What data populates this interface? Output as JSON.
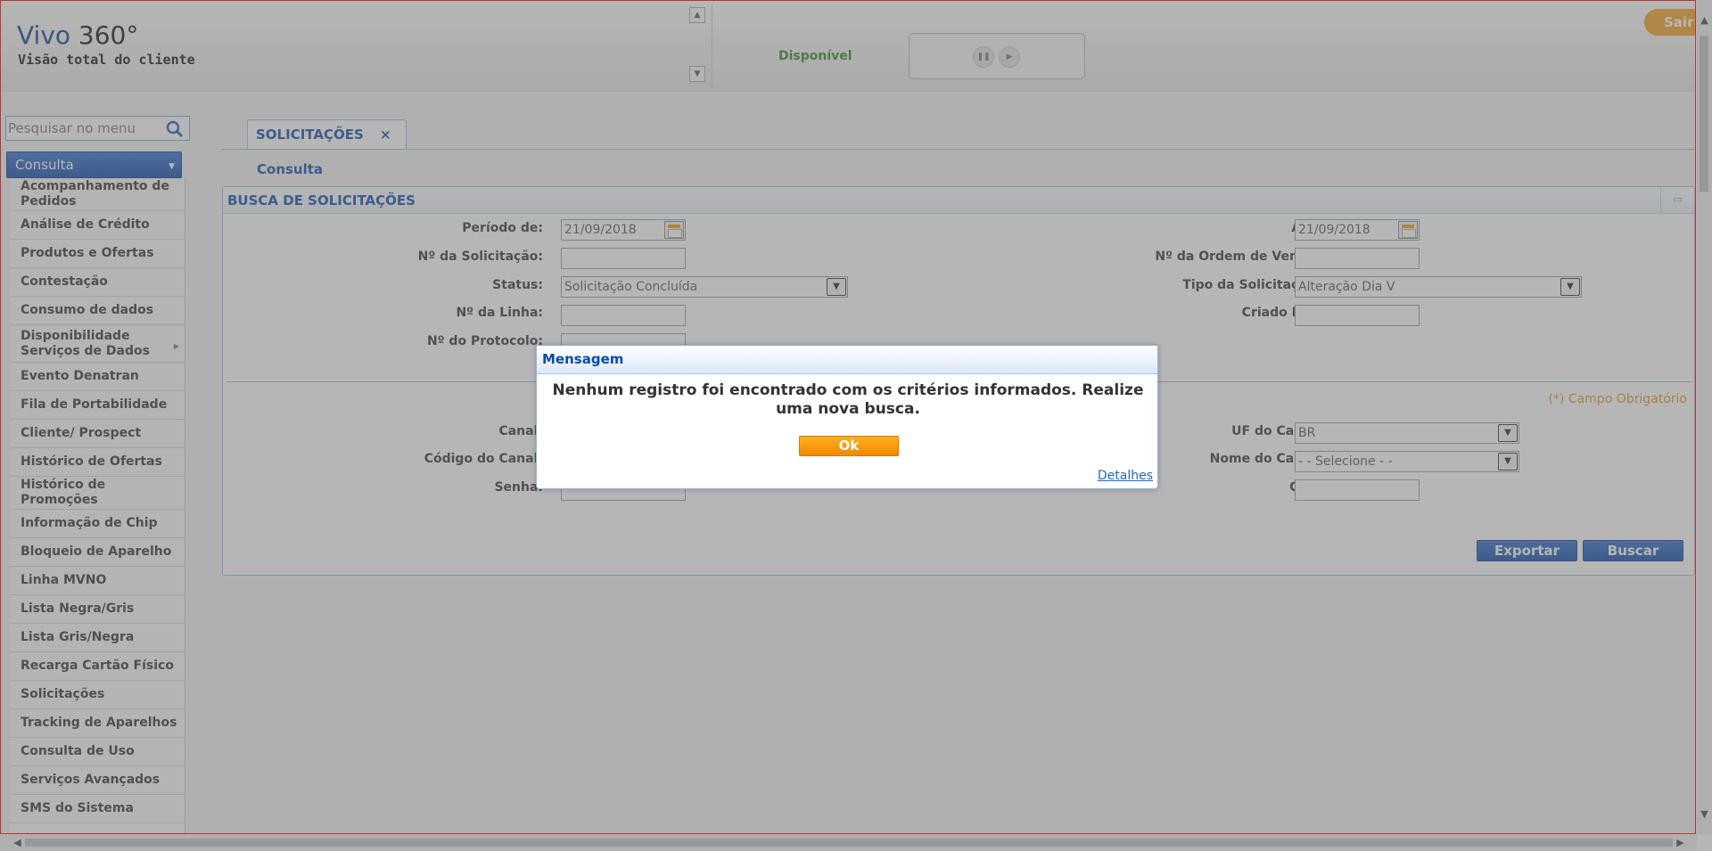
{
  "header": {
    "logo_title_a": "Vivo",
    "logo_title_b": " 360°",
    "logo_subtitle": "Visão total do cliente",
    "status": "Disponível",
    "logout_label": "Sair"
  },
  "sidebar": {
    "search_placeholder": "Pesquisar no menu",
    "menu_title": "Consulta",
    "items": [
      {
        "label": "Acompanhamento de Pedidos"
      },
      {
        "label": "Análise de Crédito"
      },
      {
        "label": "Produtos e Ofertas"
      },
      {
        "label": "Contestação"
      },
      {
        "label": "Consumo de dados"
      },
      {
        "label": "Disponibilidade Serviços de Dados"
      },
      {
        "label": "Evento Denatran"
      },
      {
        "label": "Fila de Portabilidade"
      },
      {
        "label": "Cliente/ Prospect"
      },
      {
        "label": "Histórico de Ofertas"
      },
      {
        "label": "Histórico de Promoções"
      },
      {
        "label": "Informação de Chip"
      },
      {
        "label": "Bloqueio de Aparelho"
      },
      {
        "label": "Linha MVNO"
      },
      {
        "label": "Lista Negra/Gris"
      },
      {
        "label": "Lista Gris/Negra"
      },
      {
        "label": "Recarga Cartão Físico"
      },
      {
        "label": "Solicitações"
      },
      {
        "label": "Tracking de Aparelhos"
      },
      {
        "label": "Consulta de Uso"
      },
      {
        "label": "Serviços Avançados"
      },
      {
        "label": "SMS do Sistema"
      }
    ]
  },
  "main": {
    "tab_label": "SOLICITAÇÕES",
    "tab_close": "×",
    "breadcrumb": "Consulta",
    "panel_title": "BUSCA DE SOLICITAÇÕES",
    "form": {
      "periodo_label": "Período de:",
      "periodo_value": "21/09/2018",
      "ate_label": "Até:",
      "ate_value": "21/09/2018",
      "num_solicitacao_label": "Nº da Solicitação:",
      "num_ordem_label": "Nº da Ordem de Venda:",
      "status_label": "Status:",
      "status_value": "Solicitação Concluída",
      "tipo_label": "Tipo da Solicitação:",
      "tipo_value": "Alteração Dia V",
      "num_linha_label": "Nº da Linha:",
      "criado_label": "Criado Por:",
      "num_protocolo_label": "Nº do Protocolo:",
      "required_note": "(*) Campo Obrigatório",
      "canal_label": "Canal:",
      "uf_label": "UF do Canal:",
      "uf_value": "BR",
      "codigo_label": "Código do Canal:",
      "nome_label": "Nome do Canal:",
      "nome_value": "- - Selecione - -",
      "senha_label": "Senha:",
      "cpf_label": "CPF:"
    },
    "export_label": "Exportar",
    "search_label": "Buscar"
  },
  "modal": {
    "title": "Mensagem",
    "message": "Nenhum registro foi encontrado com os critérios informados. Realize uma nova busca.",
    "ok_label": "Ok",
    "details_label": "Detalhes"
  },
  "icons": [
    "search-icon",
    "caret-down-icon",
    "chevron-right-icon",
    "close-icon",
    "calendar-icon",
    "collapse-icon",
    "pause-icon",
    "play-icon",
    "scroll-up-icon",
    "scroll-down-icon"
  ]
}
